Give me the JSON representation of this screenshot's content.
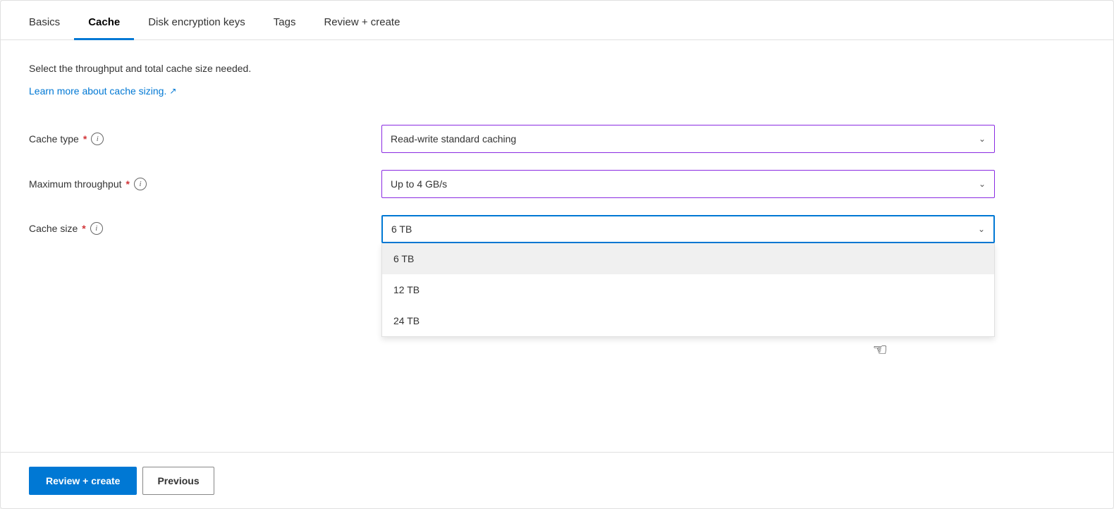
{
  "tabs": [
    {
      "id": "basics",
      "label": "Basics",
      "active": false
    },
    {
      "id": "cache",
      "label": "Cache",
      "active": true
    },
    {
      "id": "disk-encryption",
      "label": "Disk encryption keys",
      "active": false
    },
    {
      "id": "tags",
      "label": "Tags",
      "active": false
    },
    {
      "id": "review-create",
      "label": "Review + create",
      "active": false
    }
  ],
  "description": "Select the throughput and total cache size needed.",
  "learn_more_link": "Learn more about cache sizing.",
  "form": {
    "cache_type": {
      "label": "Cache type",
      "required": true,
      "value": "Read-write standard caching",
      "info_tooltip": "i"
    },
    "max_throughput": {
      "label": "Maximum throughput",
      "required": true,
      "value": "Up to 4 GB/s",
      "info_tooltip": "i"
    },
    "cache_size": {
      "label": "Cache size",
      "required": true,
      "value": "6 TB",
      "info_tooltip": "i",
      "options": [
        "6 TB",
        "12 TB",
        "24 TB"
      ]
    }
  },
  "bottom_bar": {
    "review_create_label": "Review + create",
    "previous_label": "Previous"
  }
}
